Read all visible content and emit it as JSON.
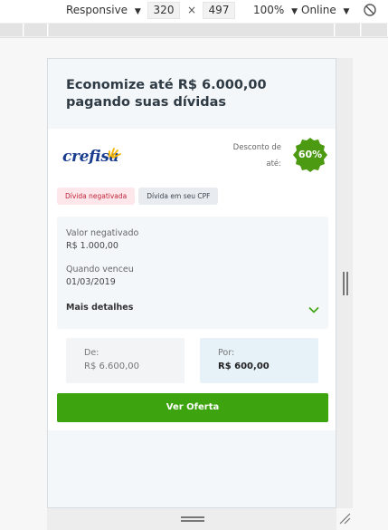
{
  "devtools": {
    "device": "Responsive",
    "width": "320",
    "height": "497",
    "times": "×",
    "zoom": "100%",
    "network": "Online",
    "caret": "▼"
  },
  "offer": {
    "headline": "Economize até R$ 6.000,00 pagando suas dívidas",
    "creditor_logo_text": "crefisa",
    "discount_label": "Desconto de até:",
    "discount_value": "60%",
    "tags": [
      "Dívida negativada",
      "Dívida em seu CPF"
    ],
    "details": {
      "negotiated_label": "Valor negativado",
      "negotiated_value": "R$ 1.000,00",
      "due_label": "Quando venceu",
      "due_value": "01/03/2019",
      "more_label": "Mais detalhes"
    },
    "price": {
      "from_label": "De:",
      "from_value": "R$ 6.600,00",
      "to_label": "Por:",
      "to_value": "R$ 600,00"
    },
    "cta_label": "Ver Oferta"
  },
  "colors": {
    "accent_green": "#3da30e",
    "badge_green": "#4c9a12",
    "logo_blue": "#1b3d8f",
    "logo_yellow": "#f5b400"
  }
}
